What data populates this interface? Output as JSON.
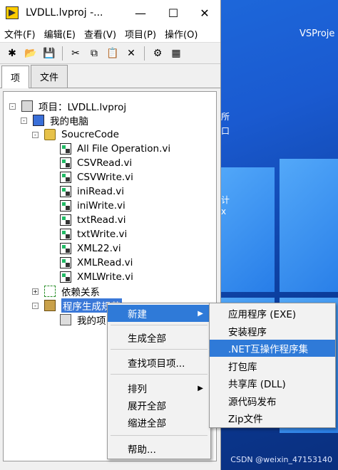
{
  "desktop": {
    "label": "VSProje",
    "watermark": "CSDN @weixin_47153140",
    "peek": [
      "所",
      "口",
      "计",
      "x"
    ]
  },
  "window": {
    "title": "LVDLL.lvproj -...",
    "controls": {
      "minimize": "—",
      "maximize": "☐",
      "close": "✕"
    }
  },
  "menubar": [
    "文件(F)",
    "编辑(E)",
    "查看(V)",
    "项目(P)",
    "操作(O)"
  ],
  "toolbar": [
    {
      "icon": "new-icon",
      "glyph": "✱"
    },
    {
      "icon": "open-folder-icon",
      "glyph": "📂"
    },
    {
      "icon": "save-all-icon",
      "glyph": "💾"
    },
    {
      "icon": "cut-icon",
      "glyph": "✂"
    },
    {
      "icon": "copy-icon",
      "glyph": "⧉"
    },
    {
      "icon": "paste-icon",
      "glyph": "📋"
    },
    {
      "icon": "delete-icon",
      "glyph": "✕"
    },
    {
      "icon": "properties-icon",
      "glyph": "⚙"
    },
    {
      "icon": "build-icon",
      "glyph": "▦"
    }
  ],
  "tabs": [
    "项",
    "文件"
  ],
  "tree": [
    {
      "label": "项目：LVDLL.lvproj",
      "icon": "project"
    },
    {
      "label": "我的电脑",
      "icon": "computer"
    },
    {
      "label": "SoucreCode",
      "icon": "folder"
    },
    {
      "label": "All File Operation.vi",
      "icon": "vi"
    },
    {
      "label": "CSVRead.vi",
      "icon": "vi"
    },
    {
      "label": "CSVWrite.vi",
      "icon": "vi"
    },
    {
      "label": "iniRead.vi",
      "icon": "vi"
    },
    {
      "label": "iniWrite.vi",
      "icon": "vi"
    },
    {
      "label": "txtRead.vi",
      "icon": "vi"
    },
    {
      "label": "txtWrite.vi",
      "icon": "vi"
    },
    {
      "label": "XML22.vi",
      "icon": "vi"
    },
    {
      "label": "XMLRead.vi",
      "icon": "vi"
    },
    {
      "label": "XMLWrite.vi",
      "icon": "vi"
    },
    {
      "label": "依赖关系",
      "icon": "deps"
    },
    {
      "label": "程序生成规范",
      "icon": "build"
    },
    {
      "label": "我的项",
      "icon": "item"
    }
  ],
  "context_menu": [
    {
      "label": "新建",
      "submenu": true,
      "highlighted": true
    },
    {
      "label": "生成全部"
    },
    {
      "label": "查找项目项..."
    },
    {
      "label": "排列",
      "submenu": true
    },
    {
      "label": "展开全部"
    },
    {
      "label": "缩进全部"
    },
    {
      "label": "帮助..."
    }
  ],
  "submenu": [
    {
      "label": "应用程序 (EXE)"
    },
    {
      "label": "安装程序"
    },
    {
      "label": ".NET互操作程序集",
      "highlighted": true
    },
    {
      "label": "打包库"
    },
    {
      "label": "共享库 (DLL)"
    },
    {
      "label": "源代码发布"
    },
    {
      "label": "Zip文件"
    }
  ]
}
